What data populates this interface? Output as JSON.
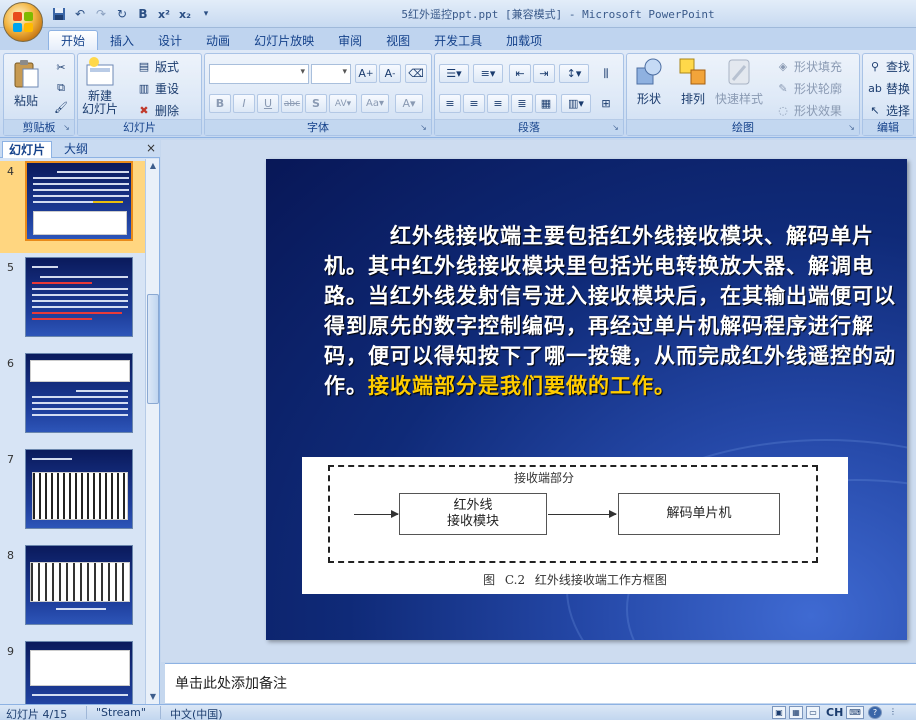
{
  "window": {
    "title": "5红外遥控ppt.ppt [兼容模式] - Microsoft PowerPoint"
  },
  "tabs": [
    "开始",
    "插入",
    "设计",
    "动画",
    "幻灯片放映",
    "审阅",
    "视图",
    "开发工具",
    "加载项"
  ],
  "ribbon": {
    "clipboard": {
      "label": "剪贴板",
      "paste": "粘贴"
    },
    "slides": {
      "label": "幻灯片",
      "new_slide_line1": "新建",
      "new_slide_line2": "幻灯片",
      "layout": "版式",
      "reset": "重设",
      "delete": "删除"
    },
    "font": {
      "label": "字体"
    },
    "paragraph": {
      "label": "段落"
    },
    "drawing": {
      "label": "绘图",
      "shapes": "形状",
      "arrange": "排列",
      "quick_styles": "快速样式",
      "shape_fill": "形状填充",
      "shape_outline": "形状轮廓",
      "shape_effects": "形状效果"
    },
    "editing": {
      "label": "编辑",
      "find": "查找",
      "replace": "替换",
      "select": "选择"
    }
  },
  "panel": {
    "tab_slides": "幻灯片",
    "tab_outline": "大纲",
    "thumbnails": [
      {
        "number": "4",
        "selected": true
      },
      {
        "number": "5",
        "selected": false
      },
      {
        "number": "6",
        "selected": false
      },
      {
        "number": "7",
        "selected": false
      },
      {
        "number": "8",
        "selected": false
      },
      {
        "number": "9",
        "selected": false
      }
    ]
  },
  "slide": {
    "text_main": "　　　红外线接收端主要包括红外线接收模块、解码单片机。其中红外线接收模块里包括光电转换放大器、解调电路。当红外线发射信号进入接收模块后，在其输出端便可以得到原先的数字控制编码，再经过单片机解码程序进行解码，便可以得知按下了哪一按键，从而完成红外线遥控的动作。",
    "text_highlight": "接收端部分是我们要做的工作。",
    "figure": {
      "group_label": "接收端部分",
      "box1": "红外线\n接收模块",
      "box2": "解码单片机",
      "caption": "图 C.2   红外线接收端工作方框图"
    }
  },
  "notes": {
    "placeholder": "单击此处添加备注"
  },
  "status": {
    "slide_info": "幻灯片 4/15",
    "theme": "\"Stream\"",
    "language": "中文(中国)",
    "ime": "CH"
  },
  "colors": {
    "accent_highlight": "#ffcc00",
    "slide_bg": "#0f2a78",
    "ribbon_bg": "#d2e1f4"
  }
}
